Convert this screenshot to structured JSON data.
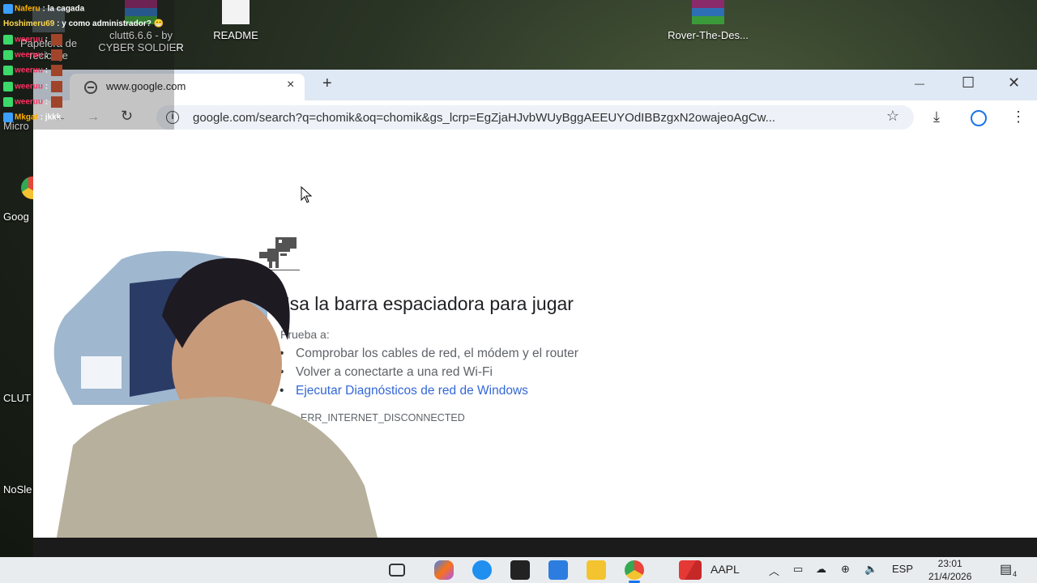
{
  "desktop": {
    "icons": [
      {
        "label": "Papelera de reciclaje"
      },
      {
        "label": "clutt6.6.6 - by CYBER SOLDIER"
      },
      {
        "label": "README"
      },
      {
        "label": "Rover-The-Des..."
      }
    ],
    "left_labels": [
      "Micro",
      "Goog",
      "CLUT",
      "NoSle"
    ]
  },
  "chat": {
    "messages": [
      {
        "user": "Naferu",
        "text": ": la cagada"
      },
      {
        "user": "Hoshimeru69",
        "text": ": y como administrador? 😁"
      },
      {
        "user": "weeruu",
        "text": ":"
      },
      {
        "user": "weeruu",
        "text": ":"
      },
      {
        "user": "weeruu",
        "text": ":"
      },
      {
        "user": "weeruu",
        "text": ":"
      },
      {
        "user": "weeruu",
        "text": ":"
      },
      {
        "user": "Mkgat",
        "text": ": jkkk"
      }
    ]
  },
  "browser": {
    "tab_title": "www.google.com",
    "tab_close": "×",
    "new_tab": "+",
    "url": "google.com/search?q=chomik&oq=chomik&gs_lcrp=EgZjaHJvbWUyBggAEEUYOdIBBzgxN2owajeoAgCw...",
    "window_controls": {
      "minimize": "—",
      "maximize": "☐",
      "close": "✕"
    },
    "nav": {
      "back": "←",
      "forward": "→",
      "reload": "↻"
    }
  },
  "error_page": {
    "title": "Usa la barra espaciadora para jugar",
    "subtitle": "Prueba a:",
    "suggestions": [
      "Comprobar los cables de red, el módem y el router",
      "Volver a conectarte a una red Wi-Fi"
    ],
    "link": "Ejecutar Diagnósticos de red de Windows",
    "error_code": "ERR_INTERNET_DISCONNECTED"
  },
  "taskbar": {
    "ticker": "AAPL",
    "language": "ESP",
    "time": "23:01",
    "date": "21/4/2026",
    "notifications": "4",
    "colors": {
      "edge": "#1f8ff0",
      "chrome": "#e8453c",
      "folder": "#f4c430",
      "store": "#1e88e5",
      "mail": "#2d7de0"
    }
  }
}
